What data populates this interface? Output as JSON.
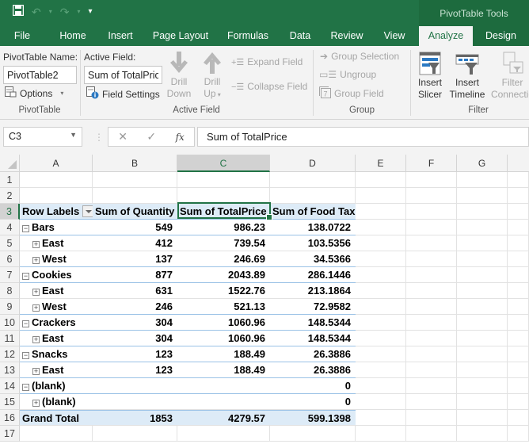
{
  "title_bar": {
    "qat": {
      "save_icon": "save-icon",
      "undo_icon": "undo-icon",
      "redo_icon": "redo-icon",
      "customize_icon": "customize-qat-icon"
    },
    "context_tools": "PivotTable Tools"
  },
  "tabs": [
    {
      "label": "File"
    },
    {
      "label": "Home"
    },
    {
      "label": "Insert"
    },
    {
      "label": "Page Layout"
    },
    {
      "label": "Formulas"
    },
    {
      "label": "Data"
    },
    {
      "label": "Review"
    },
    {
      "label": "View"
    },
    {
      "label": "Analyze",
      "active": true
    },
    {
      "label": "Design"
    }
  ],
  "ribbon": {
    "pivottable": {
      "name_label": "PivotTable Name:",
      "name_value": "PivotTable2",
      "options_label": "Options",
      "group_label": "PivotTable"
    },
    "active_field": {
      "field_label": "Active Field:",
      "field_value": "Sum of TotalPrice",
      "field_settings_label": "Field Settings",
      "drill_down_1": "Drill",
      "drill_down_2": "Down",
      "drill_up_1": "Drill",
      "drill_up_2": "Up",
      "expand_field": "Expand Field",
      "collapse_field": "Collapse Field",
      "group_label": "Active Field"
    },
    "group": {
      "group_selection": "Group Selection",
      "ungroup": "Ungroup",
      "group_field": "Group Field",
      "group_label": "Group"
    },
    "filter": {
      "insert_slicer_1": "Insert",
      "insert_slicer_2": "Slicer",
      "insert_timeline_1": "Insert",
      "insert_timeline_2": "Timeline",
      "filter_conn_1": "Filter",
      "filter_conn_2": "Connectio",
      "group_label": "Filter"
    }
  },
  "formula_bar": {
    "name_box": "C3",
    "cancel_icon": "✕",
    "enter_icon": "✓",
    "fx": "fx",
    "formula": "Sum of TotalPrice"
  },
  "sheet": {
    "columns": [
      "A",
      "B",
      "C",
      "D",
      "E",
      "F",
      "G"
    ],
    "selected_column": "C",
    "selected_row": 3,
    "rows": [
      "1",
      "2",
      "3",
      "4",
      "5",
      "6",
      "7",
      "8",
      "9",
      "10",
      "11",
      "12",
      "13",
      "14",
      "15",
      "16",
      "17"
    ],
    "pivot": {
      "headers": [
        "Row Labels",
        "Sum of Quantity",
        "Sum of TotalPrice",
        "Sum of Food Tax"
      ],
      "body": [
        {
          "label": "Bars",
          "level": 1,
          "toggle": "−",
          "qty": "549",
          "price": "986.23",
          "tax": "138.0722"
        },
        {
          "label": "East",
          "level": 2,
          "toggle": "+",
          "qty": "412",
          "price": "739.54",
          "tax": "103.5356"
        },
        {
          "label": "West",
          "level": 2,
          "toggle": "+",
          "qty": "137",
          "price": "246.69",
          "tax": "34.5366"
        },
        {
          "label": "Cookies",
          "level": 1,
          "toggle": "−",
          "qty": "877",
          "price": "2043.89",
          "tax": "286.1446"
        },
        {
          "label": "East",
          "level": 2,
          "toggle": "+",
          "qty": "631",
          "price": "1522.76",
          "tax": "213.1864"
        },
        {
          "label": "West",
          "level": 2,
          "toggle": "+",
          "qty": "246",
          "price": "521.13",
          "tax": "72.9582"
        },
        {
          "label": "Crackers",
          "level": 1,
          "toggle": "−",
          "qty": "304",
          "price": "1060.96",
          "tax": "148.5344"
        },
        {
          "label": "East",
          "level": 2,
          "toggle": "+",
          "qty": "304",
          "price": "1060.96",
          "tax": "148.5344"
        },
        {
          "label": "Snacks",
          "level": 1,
          "toggle": "−",
          "qty": "123",
          "price": "188.49",
          "tax": "26.3886"
        },
        {
          "label": "East",
          "level": 2,
          "toggle": "+",
          "qty": "123",
          "price": "188.49",
          "tax": "26.3886"
        },
        {
          "label": "(blank)",
          "level": 1,
          "toggle": "−",
          "qty": "",
          "price": "",
          "tax": "0"
        },
        {
          "label": "(blank)",
          "level": 2,
          "toggle": "+",
          "qty": "",
          "price": "",
          "tax": "0"
        }
      ],
      "grand_total": {
        "label": "Grand Total",
        "qty": "1853",
        "price": "4279.57",
        "tax": "599.1398"
      }
    }
  },
  "colors": {
    "brand": "#217346",
    "pivot_header": "#ddebf7",
    "pivot_line": "#9bc2e6"
  }
}
